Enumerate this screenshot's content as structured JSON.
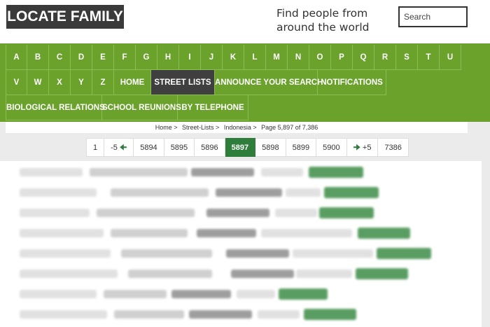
{
  "header": {
    "logo": "LOCATE FAMILY",
    "tagline": "Find people from around the world",
    "search_placeholder": "Search"
  },
  "nav": {
    "row1": [
      "A",
      "B",
      "C",
      "D",
      "E",
      "F",
      "G",
      "H",
      "I",
      "J",
      "K",
      "L",
      "M",
      "N",
      "O",
      "P",
      "Q",
      "R",
      "S",
      "T",
      "U"
    ],
    "row2_letters": [
      "V",
      "W",
      "X",
      "Y",
      "Z"
    ],
    "home": "HOME",
    "street_lists": "STREET LISTS",
    "announce": "ANNOUNCE YOUR SEARCH",
    "notifications": "NOTIFICATIONS",
    "biological": "BIOLOGICAL RELATIONS",
    "school": "SCHOOL REUNIONS",
    "telephone": "BY TELEPHONE"
  },
  "breadcrumb": {
    "home": "Home >",
    "street_lists": "Street-Lists >",
    "country": "Indonesia >",
    "page_info": "Page 5,897 of 7,386"
  },
  "pagination": {
    "first": "1",
    "back": "-5",
    "pages": [
      "5894",
      "5895",
      "5896",
      "5897",
      "5898",
      "5899",
      "5900"
    ],
    "current": "5897",
    "forward": "+5",
    "last": "7386"
  },
  "colors": {
    "nav_green": "#6aa22c",
    "active_dark": "#3f3f3f",
    "page_active_green": "#2f7d3a",
    "logo_bg": "#3a3a3a"
  },
  "icons": {
    "back_arrow": "arrow-left-icon",
    "forward_arrow": "arrow-right-icon"
  }
}
